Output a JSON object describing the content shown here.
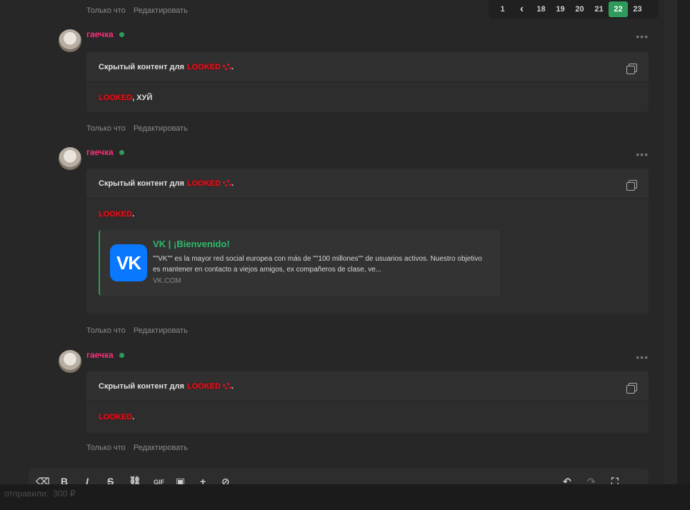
{
  "meta_actions": {
    "time": "Только что",
    "edit": "Редактировать"
  },
  "pagination": {
    "pages": [
      "1",
      "‹",
      "18",
      "19",
      "20",
      "21",
      "22",
      "23"
    ],
    "active": "22"
  },
  "posts": [
    {
      "author": "гаечка",
      "hidden_label": "Скрытый контент для",
      "hidden_user": "LOOKED",
      "body_user": "LOOKED",
      "body_text": ", ХУЙ"
    },
    {
      "author": "гаечка",
      "hidden_label": "Скрытый контент для",
      "hidden_user": "LOOKED",
      "body_user": "LOOKED",
      "body_text": ".",
      "link": {
        "title": "VK | ¡Bienvenido!",
        "description": "\"\"VK\"\" es la mayor red social europea con más de \"\"100 millones\"\" de usuarios activos. Nuestro objetivo es mantener en contacto a viejos amigos, ex compañeros de clase, ve...",
        "domain": "VK.COM",
        "logo_text": "VK"
      }
    },
    {
      "author": "гаечка",
      "hidden_label": "Скрытый контент для",
      "hidden_user": "LOOKED",
      "body_user": "LOOKED",
      "body_text": "."
    }
  ],
  "editor": {
    "gif_label": "GIF"
  },
  "bottom_bar": {
    "text": "отправили:   ⁠ 300 ₽"
  },
  "colors": {
    "accent": "#2e9a5b",
    "author": "#ff2d7a",
    "hidden_user": "#e8121e",
    "link_title": "#2dba6a",
    "vk_blue": "#0a77ff"
  }
}
